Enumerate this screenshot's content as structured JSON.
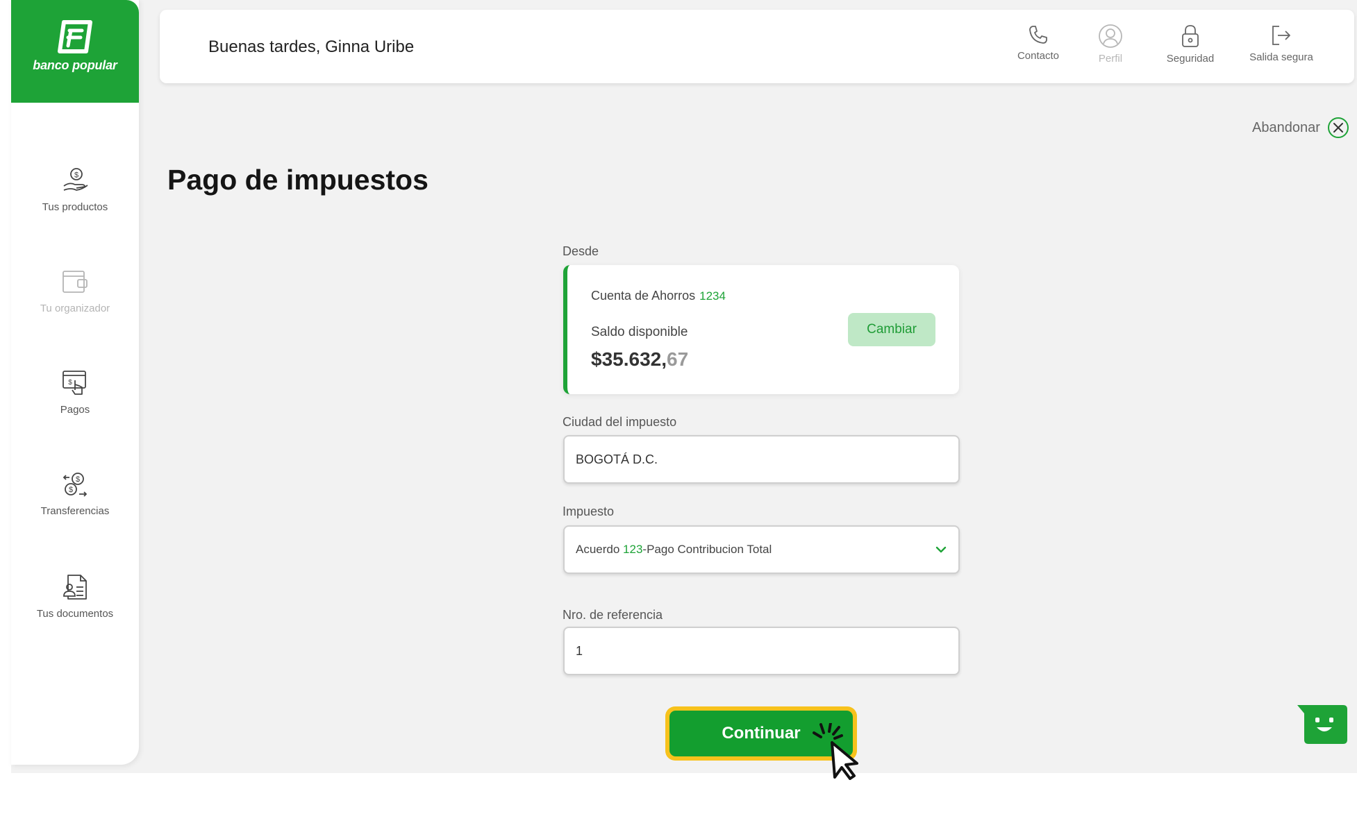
{
  "brand": {
    "name": "banco popular",
    "color": "#1ea337"
  },
  "sidebar": {
    "items": [
      {
        "label": "Tus productos",
        "icon": "hand-coin-icon",
        "enabled": true
      },
      {
        "label": "Tu organizador",
        "icon": "wallet-icon",
        "enabled": false
      },
      {
        "label": "Pagos",
        "icon": "payments-touch-icon",
        "enabled": true
      },
      {
        "label": "Transferencias",
        "icon": "transfer-coins-icon",
        "enabled": true
      },
      {
        "label": "Tus documentos",
        "icon": "documents-icon",
        "enabled": true
      }
    ]
  },
  "header": {
    "greeting": "Buenas tardes, Ginna Uribe",
    "actions": [
      {
        "label": "Contacto",
        "icon": "phone-icon"
      },
      {
        "label": "Perfil",
        "icon": "profile-icon"
      },
      {
        "label": "Seguridad",
        "icon": "lock-icon"
      },
      {
        "label": "Salida segura",
        "icon": "logout-icon"
      }
    ]
  },
  "page": {
    "abandon_label": "Abandonar",
    "title": "Pago de impuestos"
  },
  "form": {
    "desde_label": "Desde",
    "account": {
      "name": "Cuenta de Ahorros",
      "number": "1234",
      "balance_label": "Saldo disponible",
      "balance_main": "$35.632,",
      "balance_cents": "67",
      "change_label": "Cambiar"
    },
    "city": {
      "label": "Ciudad del impuesto",
      "value": "BOGOTÁ D.C."
    },
    "tax": {
      "label": "Impuesto",
      "value_prefix": "Acuerdo ",
      "value_highlight": "123",
      "value_suffix": "-Pago Contribucion Total"
    },
    "reference": {
      "label": "Nro. de referencia",
      "value": "1"
    },
    "submit_label": "Continuar"
  }
}
